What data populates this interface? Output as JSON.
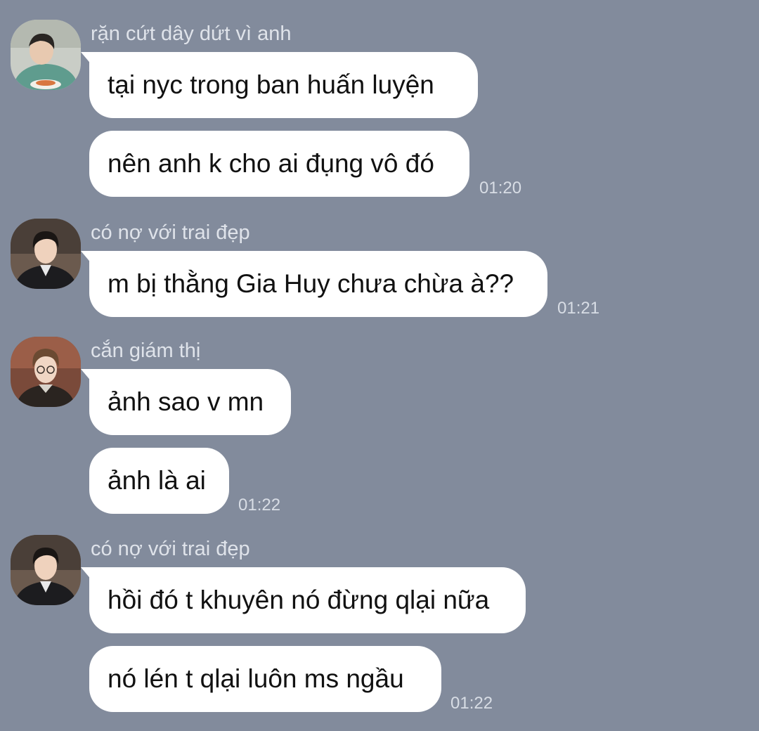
{
  "messages": [
    {
      "sender": "rặn cứt dây dứt vì anh",
      "avatar": "avatar-person-eating",
      "bubbles": [
        "tại nyc trong ban huấn luyện",
        "nên anh k cho ai đụng vô đó"
      ],
      "time": "01:20"
    },
    {
      "sender": "có nợ với trai đẹp",
      "avatar": "avatar-person-dark-jacket",
      "bubbles": [
        "m bị thằng Gia Huy chưa chừa à??"
      ],
      "time": "01:21"
    },
    {
      "sender": "cắn giám thị",
      "avatar": "avatar-person-glasses",
      "bubbles": [
        "ảnh sao v mn",
        "ảnh là ai"
      ],
      "time": "01:22"
    },
    {
      "sender": "có nợ với trai đẹp",
      "avatar": "avatar-person-dark-jacket",
      "bubbles": [
        "hồi đó t khuyên nó đừng qlại nữa",
        "nó lén t qlại luôn ms ngầu"
      ],
      "time": "01:22"
    }
  ],
  "colors": {
    "background": "#828b9c",
    "bubble": "#ffffff",
    "sender_text": "#dfe3ea",
    "time_text": "#d8dde5"
  }
}
